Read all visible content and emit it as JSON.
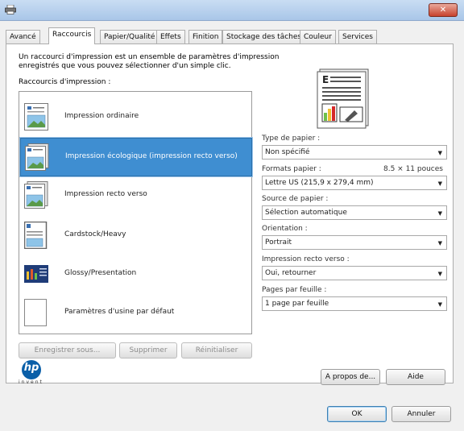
{
  "tabs": [
    "Avancé",
    "Raccourcis",
    "Papier/Qualité",
    "Effets",
    "Finition",
    "Stockage des tâches",
    "Couleur",
    "Services"
  ],
  "active_tab": "Raccourcis",
  "intro": {
    "line1": "Un raccourci d'impression est un ensemble de paramètres d'impression",
    "line2": "enregistrés que vous pouvez sélectionner d'un simple clic."
  },
  "shortcuts_label": "Raccourcis d'impression :",
  "shortcuts": [
    {
      "label": "Impression ordinaire",
      "icon": "document-image-icon"
    },
    {
      "label": "Impression écologique (impression recto verso)",
      "icon": "duplex-document-icon",
      "selected": true
    },
    {
      "label": "Impression recto verso",
      "icon": "duplex-document-icon"
    },
    {
      "label": "Cardstock/Heavy",
      "icon": "cardstock-icon"
    },
    {
      "label": "Glossy/Presentation",
      "icon": "presentation-icon"
    },
    {
      "label": "Paramètres d'usine par défaut",
      "icon": "blank-page-icon"
    }
  ],
  "list_buttons": {
    "save_as": "Enregistrer sous...",
    "delete": "Supprimer",
    "reset": "Réinitialiser"
  },
  "fields": {
    "paper_type": {
      "label": "Type de papier :",
      "value": "Non spécifié"
    },
    "paper_size": {
      "label": "Formats papier :",
      "dims": "8.5 × 11 pouces",
      "value": "Lettre US (215,9 x 279,4 mm)"
    },
    "paper_source": {
      "label": "Source de papier :",
      "value": "Sélection automatique"
    },
    "orientation": {
      "label": "Orientation :",
      "value": "Portrait"
    },
    "duplex": {
      "label": "Impression recto verso :",
      "value": "Oui, retourner"
    },
    "pages_per_sheet": {
      "label": "Pages par feuille :",
      "value": "1 page par feuille"
    }
  },
  "logo": {
    "text": "hp",
    "tagline": "invent"
  },
  "buttons": {
    "about": "A propos de...",
    "help": "Aide",
    "ok": "OK",
    "cancel": "Annuler"
  },
  "colors": {
    "selection": "#3f8ed1",
    "title_bar": "#b9d1ee",
    "close": "#c7422d",
    "hp_blue": "#0a5fa8"
  }
}
